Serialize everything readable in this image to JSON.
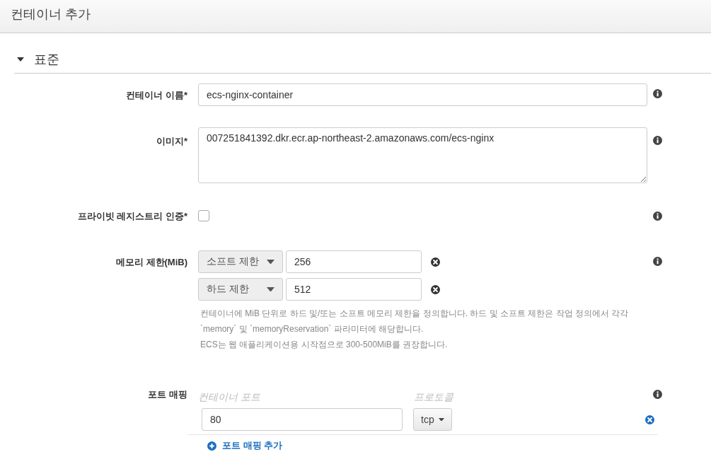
{
  "header": {
    "title": "컨테이너 추가"
  },
  "section": {
    "title": "표준",
    "expanded": true
  },
  "fields": [
    {
      "kind": "text",
      "label": "컨테이너 이름*",
      "value": "ecs-nginx-container"
    },
    {
      "kind": "textarea",
      "label": "이미지*",
      "value": "007251841392.dkr.ecr.ap-northeast-2.amazonaws.com/ecs-nginx"
    },
    {
      "kind": "checkbox",
      "label": "프라이빗 레지스트리 인증*",
      "checked": false
    },
    {
      "kind": "memory",
      "label": "메모리 제한(MiB)",
      "limits": [
        {
          "type": "소프트 제한",
          "value": "256"
        },
        {
          "type": "하드 제한",
          "value": "512"
        }
      ],
      "help": [
        "컨테이너에 MiB 단위로 하드 및/또는 소프트 메모리 제한을 정의합니다. 하드 및 소프트 제한은 작업 정의에서 각각",
        "`memory` 및 `memoryReservation` 파라미터에 해당합니다.",
        "ECS는 웹 애플리케이션용 시작점으로 300-500MiB를 권장합니다."
      ]
    },
    {
      "kind": "ports",
      "label": "포트 매핑",
      "columns": [
        "컨테이너 포트",
        "프로토콜"
      ],
      "rows": [
        {
          "port": "80",
          "protocol": "tcp"
        }
      ],
      "add_link": "포트 매핑 추가"
    }
  ]
}
